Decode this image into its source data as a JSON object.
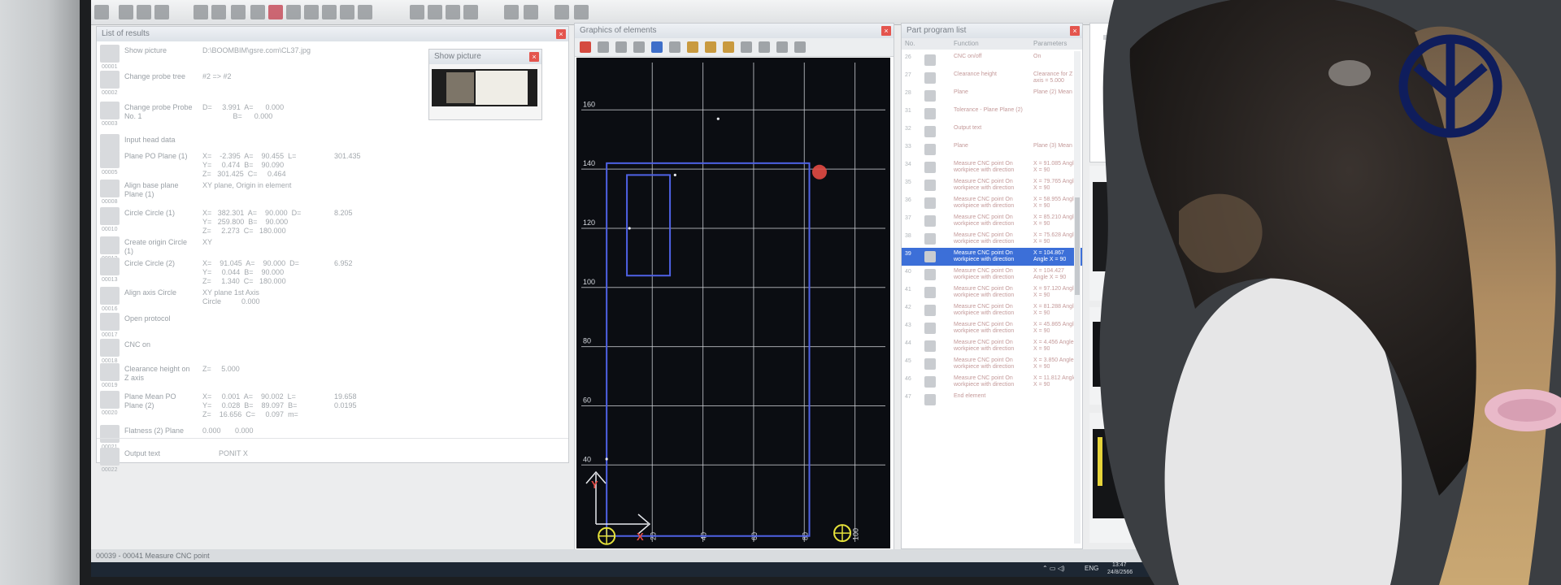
{
  "results": {
    "title": "List of results",
    "rows": [
      {
        "num": "00001",
        "label": "Show picture",
        "data": "D:\\BOOMBIM\\gsre.com\\CL37.jpg",
        "value": ""
      },
      {
        "num": "00002",
        "label": "Change probe tree",
        "data": "#2 => #2",
        "value": ""
      },
      {
        "num": "00003",
        "label": "Change probe Probe No. 1",
        "data": "D=     3.991  A=      0.000\n               B=      0.000",
        "value": ""
      },
      {
        "num": "00004",
        "label": "Input head data",
        "data": "",
        "value": ""
      },
      {
        "num": "00005",
        "label": "Plane  PO Plane (1)",
        "data": "X=    -2.395  A=    90.455  L=\nY=     0.474  B=    90.090\nZ=   301.425  C=     0.464",
        "value": "301.435"
      },
      {
        "num": "00008",
        "label": "Align base plane Plane (1)",
        "data": "XY plane, Origin in element",
        "value": ""
      },
      {
        "num": "00010",
        "label": "Circle Circle (1)",
        "data": "X=   382.301  A=    90.000  D=\nY=   259.800  B=    90.000\nZ=     2.273  C=   180.000",
        "value": "8.205"
      },
      {
        "num": "00012",
        "label": "Create origin Circle (1)",
        "data": "XY",
        "value": ""
      },
      {
        "num": "00013",
        "label": "Circle Circle (2)",
        "data": "X=    91.045  A=    90.000  D=\nY=     0.044  B=    90.000\nZ=     1.340  C=   180.000",
        "value": "6.952"
      },
      {
        "num": "00016",
        "label": "Align axis Circle",
        "data": "XY plane 1st Axis\nCircle          0.000",
        "value": ""
      },
      {
        "num": "00017",
        "label": "Open protocol",
        "data": "",
        "value": ""
      },
      {
        "num": "00018",
        "label": "CNC on",
        "data": "",
        "value": ""
      },
      {
        "num": "00019",
        "label": "Clearance height on Z axis",
        "data": "Z=     5.000",
        "value": ""
      },
      {
        "num": "00020",
        "label": "Plane  Mean  PO Plane (2)",
        "data": "X=     0.001  A=    90.002  L=\nY=     0.028  B=    89.097  B=\nZ=    16.656  C=     0.097  m=",
        "value": "19.658\n0.0195"
      },
      {
        "num": "00021",
        "label": "Flatness (2) Plane",
        "data": "0.000       0.000",
        "value": ""
      },
      {
        "num": "00022",
        "label": "Output text",
        "data": "        PONIT X",
        "value": ""
      }
    ]
  },
  "show_picture": {
    "title": "Show picture"
  },
  "graphics": {
    "title": "Graphics of elements"
  },
  "chart_data": {
    "type": "scatter",
    "title": "",
    "xlabel": "X",
    "ylabel": "Y",
    "x_ticks": [
      "20",
      "40",
      "60",
      "80",
      "100"
    ],
    "y_ticks": [
      "40",
      "60",
      "80",
      "100",
      "120",
      "140",
      "160"
    ],
    "xlim": [
      -8,
      112
    ],
    "ylim": [
      14,
      176
    ],
    "grid": true,
    "outline_rect": {
      "x0": 2,
      "y0": 16,
      "x1": 82,
      "y1": 142
    },
    "inner_rect": {
      "x0": 10,
      "y0": 104,
      "x1": 27,
      "y1": 138
    },
    "points": [
      {
        "x": 2,
        "y": 42
      },
      {
        "x": 29,
        "y": 138
      },
      {
        "x": 46,
        "y": 157
      },
      {
        "x": 11,
        "y": 120
      }
    ],
    "markers": [
      {
        "x": 2,
        "y": 16,
        "color": "#e5e13a"
      },
      {
        "x": 95,
        "y": 17,
        "color": "#e5e13a"
      },
      {
        "x": 86,
        "y": 139,
        "color": "#e24a44"
      }
    ]
  },
  "program": {
    "title": "Part program list",
    "col_no": "No.",
    "col_function": "Function",
    "col_params": "Parameters",
    "rows": [
      {
        "n": "26",
        "f": "CNC on/off",
        "v": "On"
      },
      {
        "n": "27",
        "f": "Clearance height",
        "v": "Clearance for Z axis = 5.000"
      },
      {
        "n": "28",
        "f": "Plane",
        "v": "Plane (2) Mean"
      },
      {
        "n": "31",
        "f": "Tolerance - Plane Plane (2)",
        "v": ""
      },
      {
        "n": "32",
        "f": "Output text",
        "v": ""
      },
      {
        "n": "33",
        "f": "Plane",
        "v": "Plane (3) Mean"
      },
      {
        "n": "34",
        "f": "Measure CNC point On workpiece with direction",
        "v": "X = 91.085 Angle X = 90"
      },
      {
        "n": "35",
        "f": "Measure CNC point On workpiece with direction",
        "v": "X = 79.765 Angle X = 90"
      },
      {
        "n": "36",
        "f": "Measure CNC point On workpiece with direction",
        "v": "X = 58.955 Angle X = 90"
      },
      {
        "n": "37",
        "f": "Measure CNC point On workpiece with direction",
        "v": "X = 85.210 Angle X = 90"
      },
      {
        "n": "38",
        "f": "Measure CNC point On workpiece with direction",
        "v": "X = 75.628 Angle X = 90"
      },
      {
        "n": "39",
        "f": "Measure CNC point On workpiece with direction",
        "v": "X = 104.867 Angle X = 90"
      },
      {
        "n": "40",
        "f": "Measure CNC point On workpiece with direction",
        "v": "X = 104.427 Angle X = 90"
      },
      {
        "n": "41",
        "f": "Measure CNC point On workpiece with direction",
        "v": "X = 97.120 Angle X = 90"
      },
      {
        "n": "42",
        "f": "Measure CNC point On workpiece with direction",
        "v": "X = 81.288 Angle X = 90"
      },
      {
        "n": "43",
        "f": "Measure CNC point On workpiece with direction",
        "v": "X = 45.865 Angle X = 90"
      },
      {
        "n": "44",
        "f": "Measure CNC point On workpiece with direction",
        "v": "X = 4.456 Angle X = 90"
      },
      {
        "n": "45",
        "f": "Measure CNC point On workpiece with direction",
        "v": "X = 3.850 Angle X = 90"
      },
      {
        "n": "46",
        "f": "Measure CNC point On workpiece with direction",
        "v": "X = 11.812 Angle X = 90"
      },
      {
        "n": "47",
        "f": "End element",
        "v": ""
      }
    ]
  },
  "status": {
    "text": "00039 - 00041 Measure CNC point"
  },
  "taskbar": {
    "lang": "ENG",
    "time": "13:47",
    "date": "24/8/2566"
  },
  "colors": {
    "plot_bg": "#0b0d12",
    "outline": "#4f62e6",
    "grid": "#c9ccd2",
    "selection": "#3c6fd8",
    "logo": "#0f1d5c"
  },
  "icons": {
    "logo": "stylized-y-emblem-icon"
  }
}
